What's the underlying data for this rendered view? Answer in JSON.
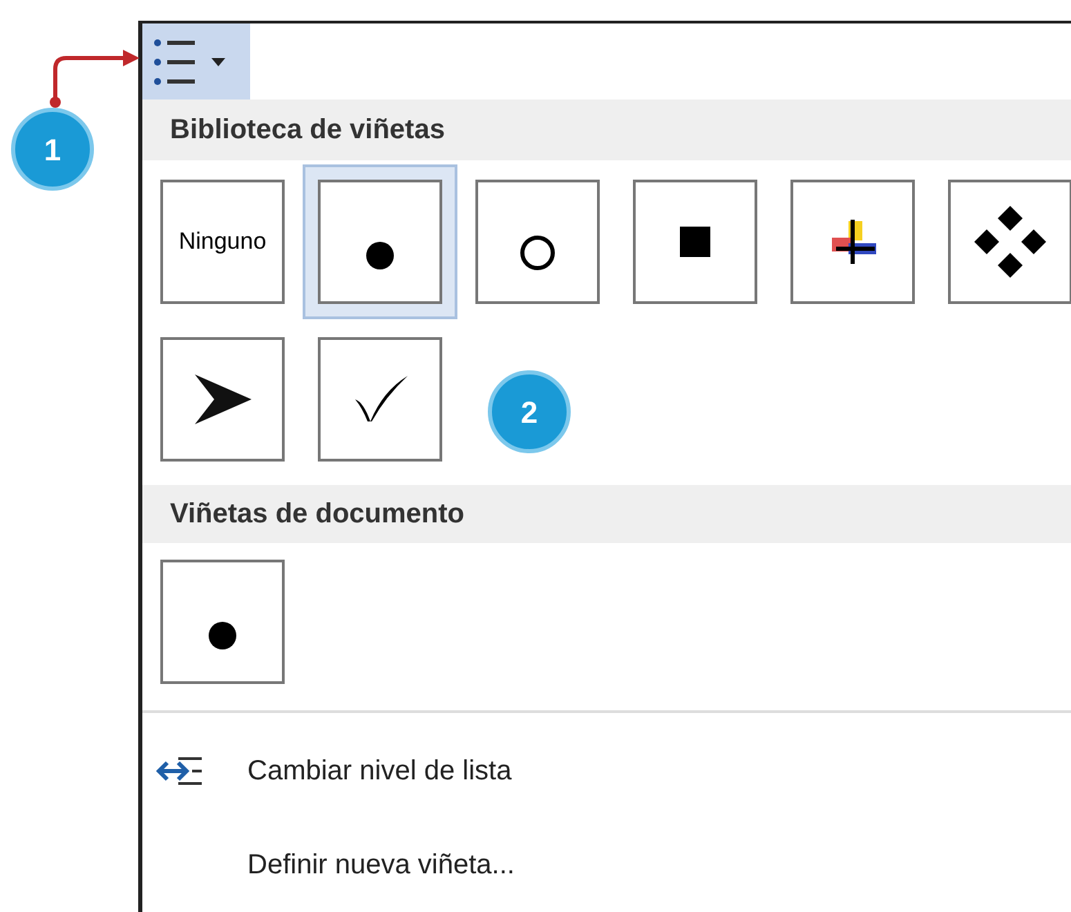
{
  "toolbar_button": {
    "selected": true
  },
  "library": {
    "title": "Biblioteca de viñetas",
    "options": [
      {
        "kind": "text",
        "label": "Ninguno",
        "selected": false
      },
      {
        "kind": "disc",
        "selected": true
      },
      {
        "kind": "circle",
        "selected": false
      },
      {
        "kind": "square",
        "selected": false
      },
      {
        "kind": "cross",
        "selected": false
      },
      {
        "kind": "diamonds",
        "selected": false
      },
      {
        "kind": "arrowhead",
        "selected": false
      },
      {
        "kind": "check",
        "selected": false
      }
    ]
  },
  "document": {
    "title": "Viñetas de documento",
    "options": [
      {
        "kind": "disc",
        "selected": false
      }
    ]
  },
  "menu": [
    {
      "kind": "level",
      "label": "Cambiar nivel de lista"
    },
    {
      "kind": "plain",
      "label": "Definir nueva viñeta..."
    }
  ],
  "callouts": [
    {
      "label": "1"
    },
    {
      "label": "2"
    }
  ]
}
